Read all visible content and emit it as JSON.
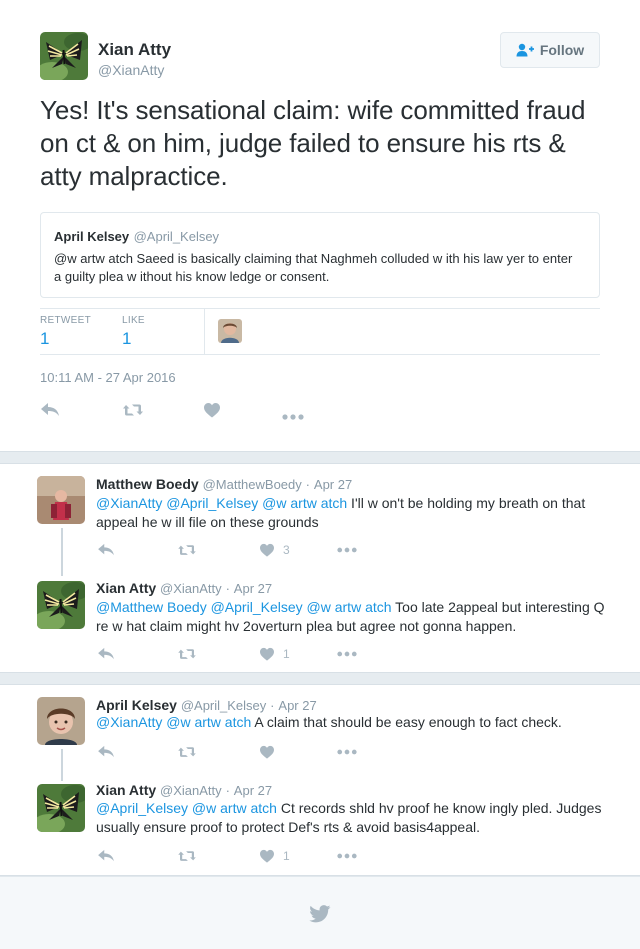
{
  "main_tweet": {
    "display_name": "Xian Atty",
    "handle": "@XianAtty",
    "follow_label": "Follow",
    "text": "Yes! It's sensational claim: wife committed fraud on ct & on him, judge failed to ensure his rts & atty malpractice.",
    "quoted": {
      "display_name": "April Kelsey",
      "handle": "@April_Kelsey",
      "text": "@w artw atch Saeed is basically claiming that Naghmeh colluded w ith his law yer to enter a guilty plea w ithout his know ledge or consent."
    },
    "stats": {
      "retweet_label": "RETWEET",
      "retweet_count": "1",
      "like_label": "LIKE",
      "like_count": "1"
    },
    "timestamp": "10:11 AM - 27 Apr 2016"
  },
  "replies": [
    {
      "display_name": "Matthew Boedy",
      "handle": "@MatthewBoedy",
      "sep": "·",
      "date": "Apr 27",
      "mentions": "@XianAtty @April_Kelsey @w artw atch",
      "text": " I'll w on't be holding my breath on that appeal he w ill file on these grounds",
      "like_count": "3"
    },
    {
      "display_name": "Xian Atty",
      "handle": "@XianAtty",
      "sep": "·",
      "date": "Apr 27",
      "mentions": "@Matthew Boedy @April_Kelsey @w artw atch",
      "text": " Too late 2appeal but interesting Q re w hat claim might hv 2overturn plea but agree not gonna happen.",
      "like_count": "1"
    },
    {
      "display_name": "April Kelsey",
      "handle": "@April_Kelsey",
      "sep": "·",
      "date": "Apr 27",
      "mentions": "@XianAtty @w artw atch",
      "text": " A claim that should be easy enough to fact check.",
      "like_count": ""
    },
    {
      "display_name": "Xian Atty",
      "handle": "@XianAtty",
      "sep": "·",
      "date": "Apr 27",
      "mentions": "@April_Kelsey @w artw atch",
      "text": " Ct records shld hv proof he know ingly pled. Judges usually ensure proof to protect Def's rts & avoid basis4appeal.",
      "like_count": "1"
    }
  ],
  "footer": {
    "icon": "twitter-bird-icon"
  },
  "colors": {
    "link": "#1b95e0",
    "muted": "#8899a6",
    "icon": "#aab8c2",
    "background": "#e6ecf0"
  }
}
